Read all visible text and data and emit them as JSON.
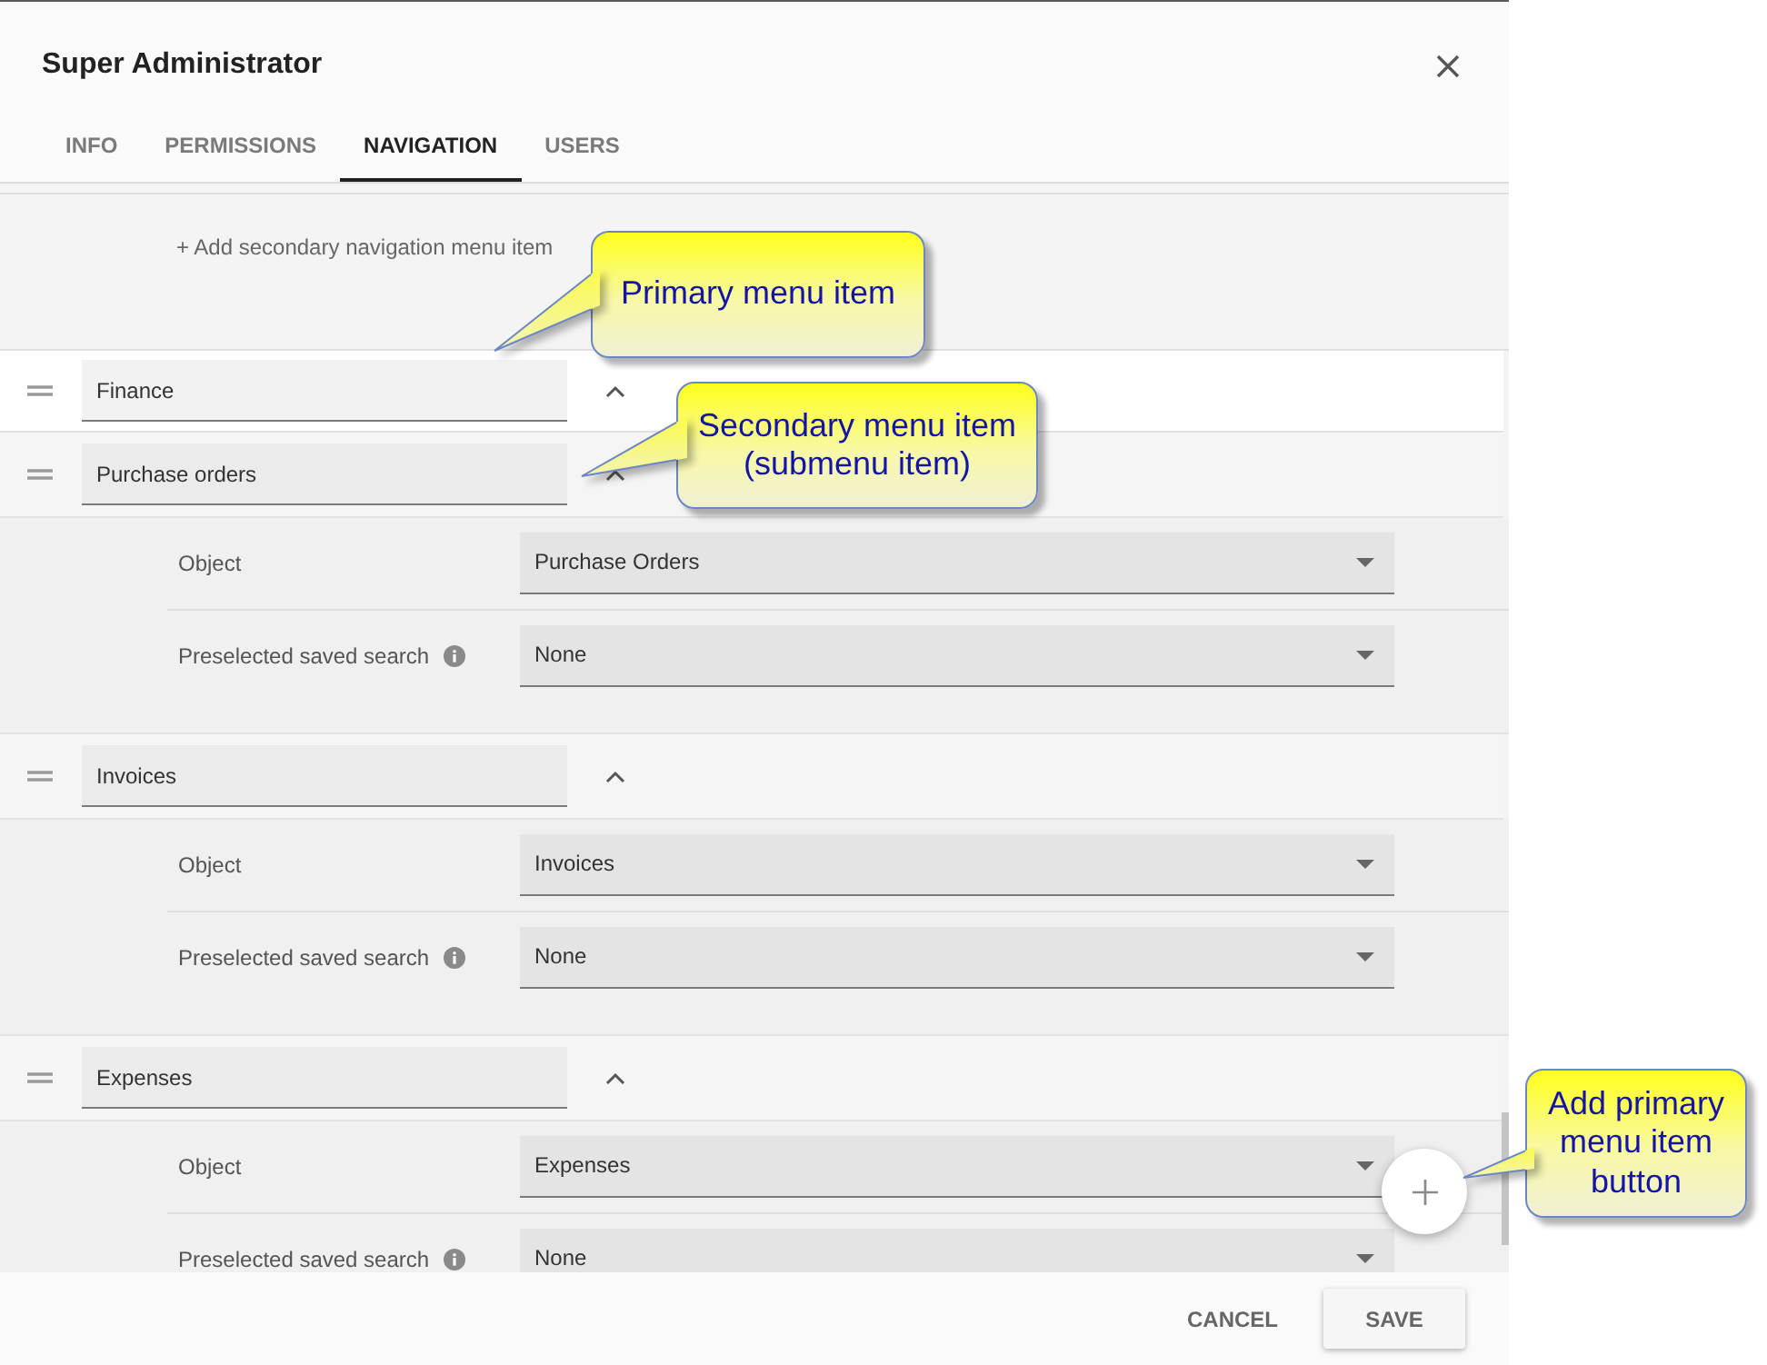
{
  "dialog": {
    "title": "Super Administrator"
  },
  "tabs": [
    {
      "label": "INFO",
      "selected": false
    },
    {
      "label": "PERMISSIONS",
      "selected": false
    },
    {
      "label": "NAVIGATION",
      "selected": true
    },
    {
      "label": "USERS",
      "selected": false
    }
  ],
  "add_secondary_link": "+ Add secondary navigation menu item",
  "primary_items": [
    {
      "label": "Finance",
      "expanded": true,
      "children": [
        {
          "label": "Purchase orders",
          "expanded": true,
          "fields": [
            {
              "label": "Object",
              "value": "Purchase Orders",
              "info": false
            },
            {
              "label": "Preselected saved search",
              "value": "None",
              "info": true
            }
          ]
        },
        {
          "label": "Invoices",
          "expanded": true,
          "fields": [
            {
              "label": "Object",
              "value": "Invoices",
              "info": false
            },
            {
              "label": "Preselected saved search",
              "value": "None",
              "info": true
            }
          ]
        },
        {
          "label": "Expenses",
          "expanded": true,
          "fields": [
            {
              "label": "Object",
              "value": "Expenses",
              "info": false
            },
            {
              "label": "Preselected saved search",
              "value": "None",
              "info": true
            }
          ]
        }
      ]
    }
  ],
  "buttons": [
    {
      "label": "CANCEL",
      "kind": "flat"
    },
    {
      "label": "SAVE",
      "kind": "raised"
    }
  ],
  "callouts": [
    {
      "text": "Primary menu item"
    },
    {
      "text": "Secondary menu item (submenu item)"
    },
    {
      "text": "Add primary menu item button"
    }
  ]
}
